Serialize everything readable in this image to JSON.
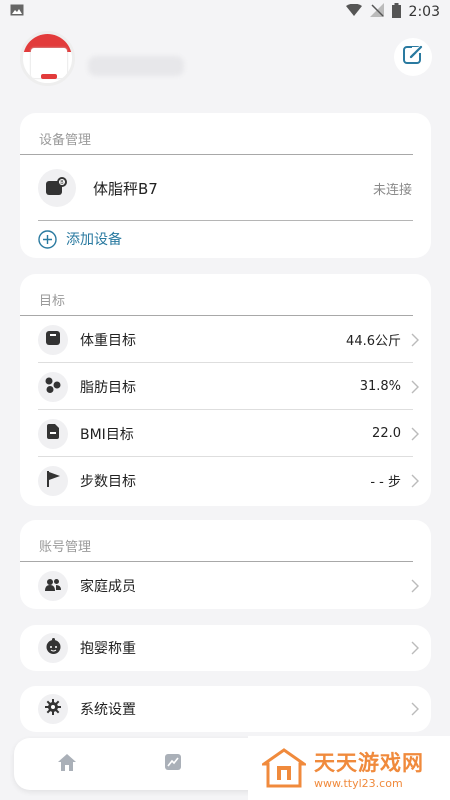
{
  "status_bar": {
    "time": "2:03"
  },
  "devices": {
    "section_title": "设备管理",
    "device_name": "体脂秤B7",
    "device_status": "未连接",
    "add_label": "添加设备"
  },
  "goals": {
    "section_title": "目标",
    "items": [
      {
        "label": "体重目标",
        "value": "44.6公斤",
        "icon": "scale-icon"
      },
      {
        "label": "脂肪目标",
        "value": "31.8%",
        "icon": "fat-icon"
      },
      {
        "label": "BMI目标",
        "value": "22.0",
        "icon": "bmi-icon"
      },
      {
        "label": "步数目标",
        "value": "- - 步",
        "icon": "flag-icon"
      }
    ]
  },
  "account": {
    "section_title": "账号管理",
    "family_label": "家庭成员"
  },
  "baby": {
    "label": "抱婴称重"
  },
  "settings": {
    "label": "系统设置"
  },
  "watermark": {
    "title": "天天游戏网",
    "url": "www.ttyl23.com"
  },
  "colors": {
    "accent": "#2a7aa0",
    "background": "#f4f4f6"
  }
}
